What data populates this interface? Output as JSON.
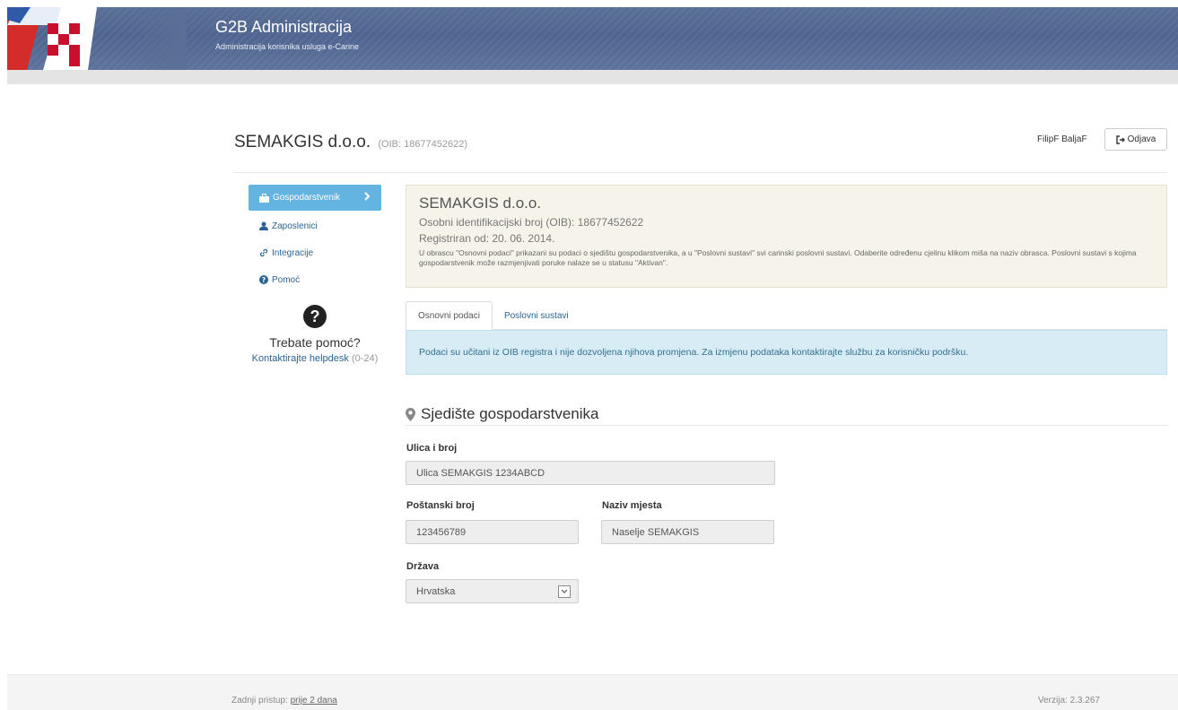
{
  "header": {
    "title": "G2B Administracija",
    "subtitle": "Administracija korisnika usluga e-Carine"
  },
  "company": {
    "name": "SEMAKGIS d.o.o.",
    "oib_label": "(OIB: 18677452622)"
  },
  "user": {
    "name": "FilipF BaljaF",
    "logout_label": "Odjava"
  },
  "sidebar": {
    "items": [
      {
        "label": "Gospodarstvenik",
        "icon": "briefcase-icon",
        "active": true
      },
      {
        "label": "Zaposlenici",
        "icon": "user-icon"
      },
      {
        "label": "Integracije",
        "icon": "link-icon"
      },
      {
        "label": "Pomoć",
        "icon": "question-icon"
      }
    ],
    "help_title": "Trebate pomoć?",
    "help_link": "Kontaktirajte helpdesk",
    "help_hours": "(0-24)"
  },
  "info": {
    "company_name": "SEMAKGIS d.o.o.",
    "oib_line": "Osobni identifikacijski broj (OIB): 18677452622",
    "registered_line": "Registriran od: 20. 06. 2014.",
    "description": "U obrascu \"Osnovni podaci\" prikazani su podaci o sjedištu gospodarstvenika, a u \"Poslovni sustavi\" svi carinski poslovni sustavi. Odaberite određenu cjelinu klikom miša na naziv obrasca. Poslovni sustavi s kojima gospodarstvenik može razmjenjivati poruke nalaze se u statusu \"Aktivan\"."
  },
  "tabs": [
    {
      "label": "Osnovni podaci",
      "active": true
    },
    {
      "label": "Poslovni sustavi"
    }
  ],
  "alert": "Podaci su učitani iz OIB registra i nije dozvoljena njihova promjena. Za izmjenu podataka kontaktirajte službu za korisničku podršku.",
  "section": {
    "title": "Sjedište gospodarstvenika",
    "street_label": "Ulica i broj",
    "street_value": "Ulica SEMAKGIS 1234ABCD",
    "postal_label": "Poštanski broj",
    "postal_value": "123456789",
    "place_label": "Naziv mjesta",
    "place_value": "Naselje SEMAKGIS",
    "country_label": "Država",
    "country_value": "Hrvatska"
  },
  "footer": {
    "last_access_label": "Zadnji pristup:",
    "last_access_value": "prije 2 dana",
    "version": "Verzija: 2.3.267"
  },
  "colors": {
    "header_blue": "#54698f",
    "active_nav": "#63b4e0",
    "link_blue": "#2a6496",
    "alert_bg": "#d8ecf5",
    "info_panel_bg": "#f6f4ea"
  }
}
